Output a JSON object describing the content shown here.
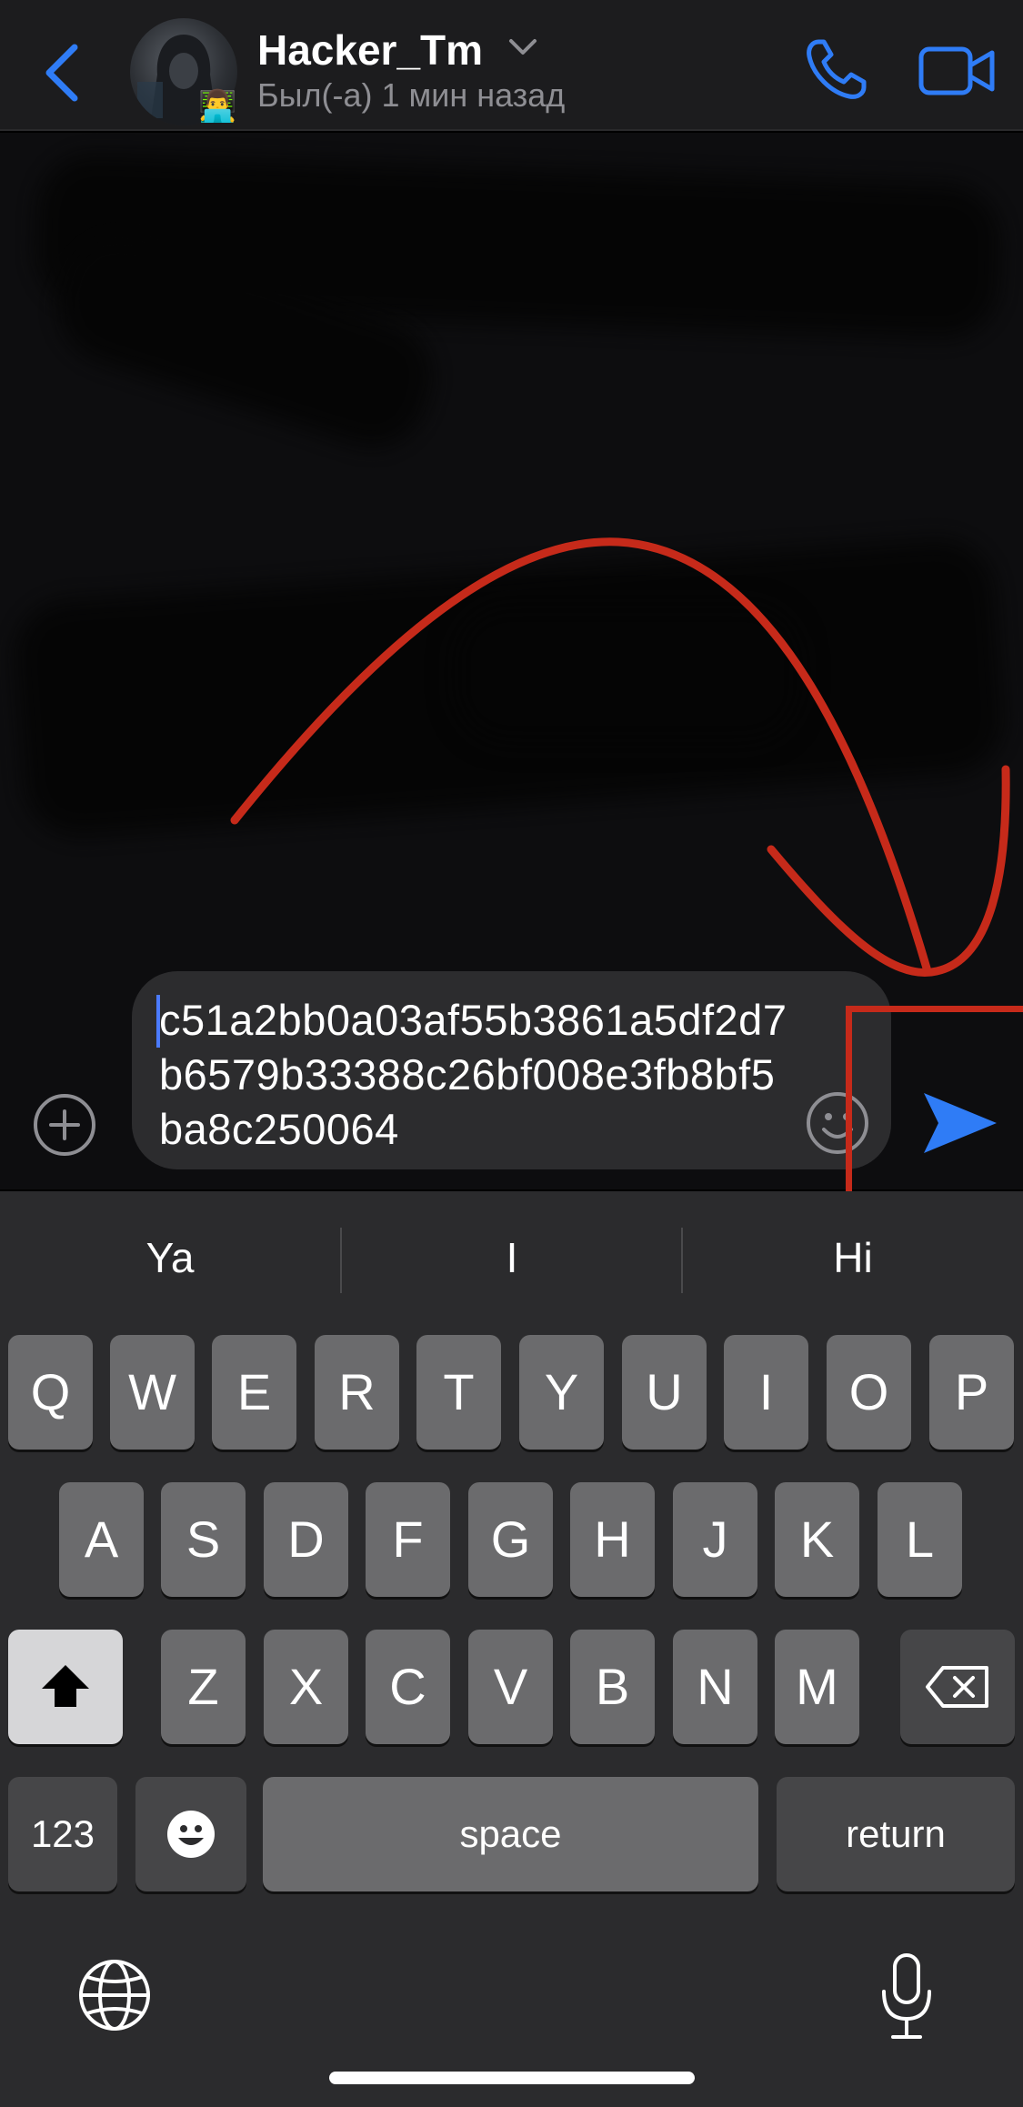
{
  "header": {
    "contact_name": "Hacker_Tm",
    "status": "Был(-а) 1 мин назад",
    "avatar_badge": "👨‍💻",
    "accent_color": "#2f7cf6"
  },
  "composer": {
    "message_text": "c51a2bb0a03af55b3861a5df2d7b6579b33388c26bf008e3fb8bf5ba8c250064",
    "send_color": "#2f7cf6"
  },
  "annotation": {
    "color": "#c62a1a"
  },
  "keyboard": {
    "suggestions": [
      "Ya",
      "I",
      "Hi"
    ],
    "row1": [
      "Q",
      "W",
      "E",
      "R",
      "T",
      "Y",
      "U",
      "I",
      "O",
      "P"
    ],
    "row2": [
      "A",
      "S",
      "D",
      "F",
      "G",
      "H",
      "J",
      "K",
      "L"
    ],
    "row3": [
      "Z",
      "X",
      "C",
      "V",
      "B",
      "N",
      "M"
    ],
    "numbers_label": "123",
    "space_label": "space",
    "return_label": "return"
  },
  "icons": {
    "back": "chevron-left-icon",
    "call": "phone-icon",
    "video": "video-camera-icon",
    "attach": "plus-circle-icon",
    "emoji": "smiley-icon",
    "send": "send-arrow-icon",
    "shift": "shift-arrow-icon",
    "delete": "backspace-icon",
    "globe": "globe-icon",
    "mic": "microphone-icon"
  }
}
